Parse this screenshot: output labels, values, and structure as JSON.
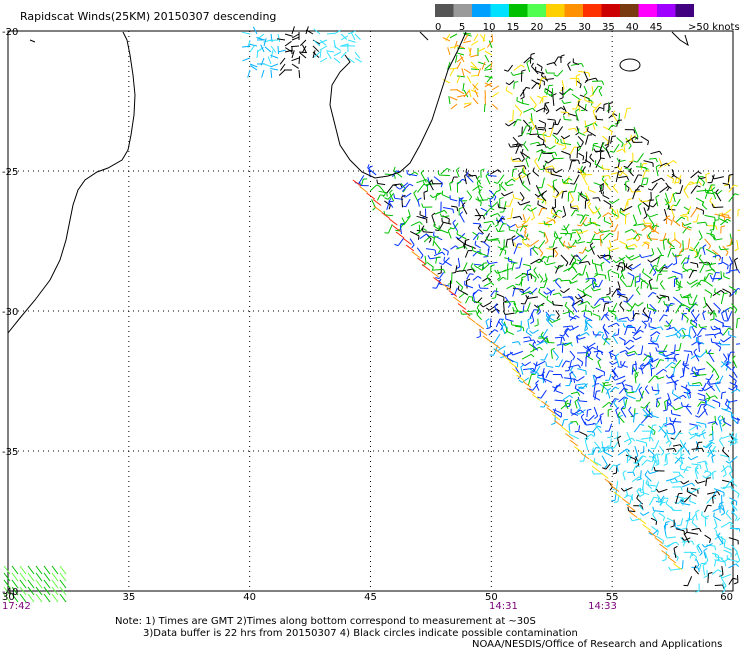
{
  "title": "Rapidscat Winds(25KM) 20150307 descending",
  "legend": {
    "colors": [
      "#555555",
      "#9a9a9a",
      "#00a0ff",
      "#00e0ff",
      "#00c000",
      "#50ff50",
      "#ffd000",
      "#ff9000",
      "#ff3000",
      "#cc0000",
      "#7a3a10",
      "#ff00ff",
      "#a000ff",
      "#400080"
    ],
    "labels": [
      "0",
      "5",
      "10",
      "15",
      "20",
      "25",
      "30",
      "35",
      "40",
      "45",
      ">50 knots"
    ]
  },
  "axes": {
    "lon_labels": [
      "30",
      "35",
      "40",
      "45",
      "50",
      "55",
      "60"
    ],
    "lat_labels": [
      "-20",
      "-25",
      "-30",
      "-35",
      "-40"
    ],
    "lon_range": [
      30,
      60
    ],
    "lat_range": [
      -20,
      -40
    ]
  },
  "times": [
    {
      "label": "17:42",
      "lon": 30
    },
    {
      "label": "14:31",
      "lon": 50.5
    },
    {
      "label": "14:33",
      "lon": 54.6
    }
  ],
  "notes": {
    "line1": "Note: 1) Times are GMT 2)Times along bottom correspond to measurement at ~30S",
    "line2": "3)Data buffer is 22 hrs from 20150307 4) Black circles indicate possible contamination",
    "credit": "NOAA/NESDIS/Office of Research and Applications"
  }
}
